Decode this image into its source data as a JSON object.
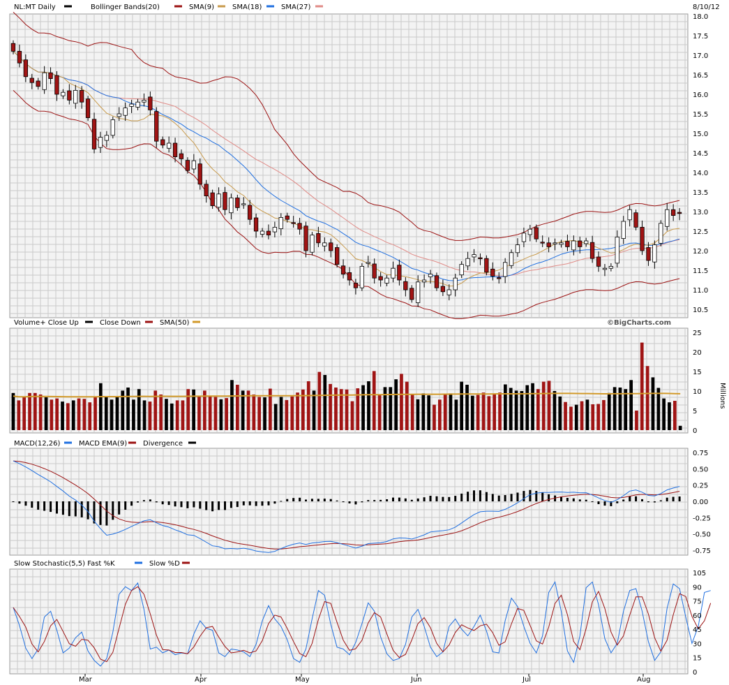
{
  "header": {
    "symbol": "NL:MT Daily",
    "date": "8/10/12",
    "legend": [
      {
        "label": "Bollinger Bands(20)",
        "color": "#9b1111"
      },
      {
        "label": "SMA(9)",
        "color": "#c89a4b"
      },
      {
        "label": "SMA(18)",
        "color": "#1f6fe0"
      },
      {
        "label": "SMA(27)",
        "color": "#e08a86"
      }
    ]
  },
  "volume_panel": {
    "legend": [
      {
        "label": "Volume+ Close Up",
        "color": "#000000"
      },
      {
        "label": "Close Down",
        "color": "#9b1111"
      },
      {
        "label": "SMA(50)",
        "color": "#d29a2a"
      }
    ],
    "watermark": "©BigCharts.com",
    "unit_label": "Millions"
  },
  "macd_panel": {
    "legend": [
      {
        "label": "MACD(12,26)",
        "color": "#1f6fe0"
      },
      {
        "label": "MACD EMA(9)",
        "color": "#9b1111"
      },
      {
        "label": "Divergence",
        "color": "#000000"
      }
    ]
  },
  "stoch_panel": {
    "legend": [
      {
        "label": "Slow Stochastic(5,5) Fast %K",
        "color": "#1f6fe0"
      },
      {
        "label": "Slow %D",
        "color": "#9b1111"
      }
    ]
  },
  "x_axis": {
    "months": [
      "Mar",
      "Apr",
      "May",
      "Jun",
      "Jul",
      "Aug"
    ]
  },
  "chart_data": [
    {
      "type": "candlestick",
      "name": "price",
      "ylim": [
        10.5,
        18.0
      ],
      "yticks": [
        "18.0",
        "17.5",
        "17.0",
        "16.5",
        "16.0",
        "15.5",
        "15.0",
        "14.5",
        "14.0",
        "13.5",
        "13.0",
        "12.5",
        "12.0",
        "11.5",
        "11.0",
        "10.5"
      ],
      "close": [
        17.1,
        16.8,
        16.45,
        16.3,
        16.2,
        16.55,
        16.4,
        16.0,
        16.05,
        15.85,
        16.1,
        15.8,
        15.4,
        14.6,
        14.9,
        14.95,
        15.35,
        15.5,
        15.65,
        15.75,
        15.8,
        15.85,
        15.6,
        14.8,
        14.7,
        14.75,
        14.4,
        14.35,
        14.05,
        14.3,
        13.7,
        13.4,
        13.15,
        13.45,
        13.05,
        13.35,
        13.1,
        13.2,
        12.8,
        12.5,
        12.5,
        12.4,
        12.6,
        12.85,
        12.8,
        12.7,
        12.55,
        12.0,
        12.4,
        12.2,
        12.2,
        12.0,
        11.65,
        11.4,
        11.25,
        11.05,
        11.6,
        11.7,
        11.3,
        11.25,
        11.3,
        11.55,
        11.25,
        11.0,
        10.75,
        11.2,
        11.25,
        11.4,
        11.05,
        10.95,
        11.0,
        11.3,
        11.65,
        11.8,
        11.9,
        11.8,
        11.45,
        11.35,
        11.3,
        11.7,
        11.95,
        12.15,
        12.45,
        12.55,
        12.3,
        12.2,
        12.1,
        12.2,
        12.2,
        12.1,
        12.25,
        12.1,
        12.25,
        11.8,
        11.6,
        11.55,
        11.6,
        12.35,
        12.75,
        13.05,
        12.6,
        12.0,
        11.75,
        12.15,
        12.7,
        13.05,
        12.9,
        12.95
      ],
      "sma9_first_last": [
        16.4,
        12.65
      ],
      "sma18_first_last": [
        16.3,
        12.5
      ],
      "sma27_first_last": [
        16.05,
        12.4
      ],
      "bollinger_upper_first_last": [
        17.3,
        13.45
      ],
      "bollinger_lower_first_last": [
        15.0,
        11.5
      ]
    },
    {
      "type": "bar",
      "name": "volume",
      "ylim": [
        0,
        25
      ],
      "yticks": [
        "25",
        "20",
        "15",
        "10",
        "5",
        "0"
      ],
      "ylabel": "Millions",
      "values": [
        9.5,
        7.6,
        8.6,
        9.5,
        9.5,
        9.1,
        8.4,
        7.8,
        8.1,
        7.3,
        6.9,
        7.6,
        8.1,
        8.0,
        7.1,
        8.4,
        12.0,
        8.6,
        7.8,
        8.4,
        10.1,
        10.9,
        7.8,
        10.5,
        7.6,
        7.3,
        10.1,
        9.1,
        8.0,
        6.8,
        7.6,
        7.6,
        10.5,
        10.4,
        8.6,
        10.1,
        8.8,
        8.5,
        7.9,
        8.2,
        12.8,
        11.6,
        10.1,
        10.1,
        9.1,
        8.5,
        8.4,
        10.6,
        6.7,
        8.5,
        7.7,
        8.6,
        9.6,
        10.4,
        12.5,
        10.1,
        14.9,
        14.1,
        11.8,
        10.9,
        10.5,
        10.4,
        7.4,
        10.7,
        11.5,
        12.5,
        15.1,
        9.2,
        11.0,
        11.0,
        13.0,
        14.4,
        12.4,
        9.1,
        7.9,
        9.4,
        8.9,
        6.5,
        7.8,
        9.2,
        9.4,
        7.8,
        12.4,
        11.6,
        8.8,
        9.0,
        9.6,
        8.7,
        9.2,
        9.6,
        11.7,
        10.8,
        10.1,
        10.0,
        11.5,
        12.0,
        10.5,
        12.4,
        12.6,
        10.0,
        8.6,
        7.2,
        6.0,
        6.5,
        7.4,
        7.8,
        6.6,
        6.7,
        7.7,
        9.5,
        11.0,
        10.9,
        10.5,
        12.8,
        5.0,
        22.4,
        16.4,
        13.5,
        10.8,
        8.1,
        7.1,
        7.5,
        1.1
      ],
      "sma50_first_last": [
        8.0,
        8.8
      ]
    },
    {
      "type": "line",
      "name": "macd",
      "ylim": [
        -0.75,
        0.75
      ],
      "yticks": [
        "0.75",
        "0.50",
        "0.25",
        "0.00",
        "-0.25",
        "-0.50",
        "-0.75"
      ],
      "macd_first_last": [
        0.62,
        0.22
      ],
      "signal_first_last": [
        0.62,
        0.17
      ],
      "divergence_range": [
        -0.22,
        0.16
      ]
    },
    {
      "type": "line",
      "name": "slow-stochastic",
      "ylim": [
        0,
        105
      ],
      "yticks": [
        "105",
        "90",
        "75",
        "60",
        "45",
        "30",
        "15",
        "0"
      ],
      "fast_k": [
        68,
        49,
        25,
        14,
        24,
        58,
        64,
        44,
        20,
        25,
        36,
        42,
        22,
        12,
        6,
        14,
        42,
        82,
        90,
        86,
        94,
        66,
        24,
        26,
        20,
        23,
        18,
        20,
        19,
        40,
        54,
        46,
        44,
        20,
        16,
        24,
        23,
        21,
        16,
        29,
        54,
        70,
        56,
        48,
        34,
        14,
        10,
        24,
        56,
        86,
        81,
        50,
        26,
        24,
        18,
        31,
        51,
        73,
        64,
        37,
        19,
        12,
        14,
        29,
        58,
        66,
        48,
        26,
        16,
        21,
        48,
        56,
        45,
        38,
        48,
        60,
        43,
        21,
        20,
        54,
        78,
        69,
        48,
        30,
        20,
        38,
        84,
        95,
        64,
        22,
        10,
        38,
        89,
        95,
        71,
        35,
        20,
        30,
        64,
        86,
        88,
        64,
        32,
        12,
        21,
        67,
        93,
        88,
        58,
        30,
        48,
        84,
        86
      ]
    }
  ]
}
